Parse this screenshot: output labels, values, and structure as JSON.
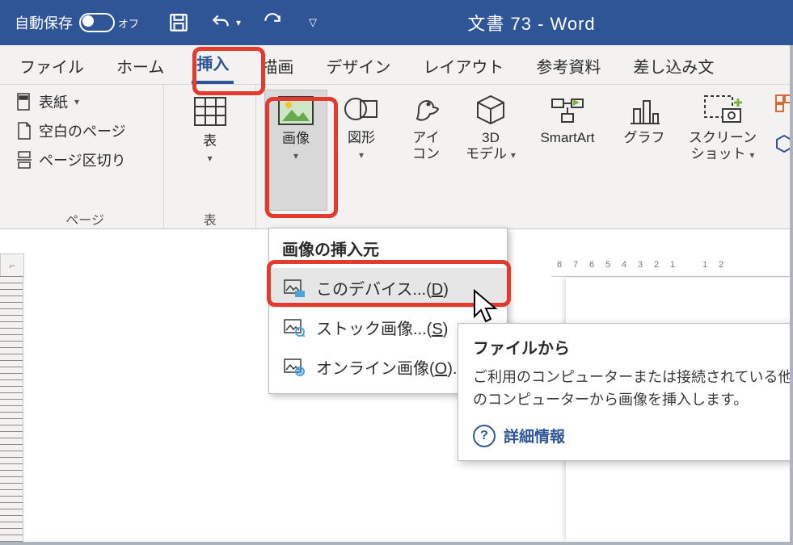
{
  "titlebar": {
    "autosave_label": "自動保存",
    "autosave_state": "オフ",
    "document_title": "文書 73  -  Word"
  },
  "tabs": {
    "items": [
      {
        "label": "ファイル"
      },
      {
        "label": "ホーム"
      },
      {
        "label": "挿入",
        "active": true
      },
      {
        "label": "描画"
      },
      {
        "label": "デザイン"
      },
      {
        "label": "レイアウト"
      },
      {
        "label": "参考資料"
      },
      {
        "label": "差し込み文"
      }
    ]
  },
  "ribbon": {
    "pages_group": {
      "caption": "ページ",
      "cover": "表紙",
      "blank": "空白のページ",
      "break": "ページ区切り"
    },
    "tables_group": {
      "caption": "表",
      "table": "表"
    },
    "illust_group": {
      "image": "画像",
      "shapes": "図形",
      "icons_l1": "アイ",
      "icons_l2": "コン",
      "model_l1": "3D",
      "model_l2": "モデル",
      "smartart": "SmartArt",
      "chart": "グラフ",
      "screenshot_l1": "スクリーン",
      "screenshot_l2": "ショット"
    }
  },
  "dropdown": {
    "title": "画像の挿入元",
    "items": [
      {
        "label": "このデバイス...(",
        "mnemonic": "D",
        "tail": ")"
      },
      {
        "label": "ストック画像...(",
        "mnemonic": "S",
        "tail": ")"
      },
      {
        "label": "オンライン画像(",
        "mnemonic": "O",
        "tail": ")..."
      }
    ]
  },
  "tooltip": {
    "title": "ファイルから",
    "body": "ご利用のコンピューターまたは接続されている他のコンピューターから画像を挿入します。",
    "link": "詳細情報"
  },
  "hruler_ticks": [
    "8",
    "7",
    "6",
    "5",
    "4",
    "3",
    "2",
    "1",
    "",
    "1",
    "2"
  ]
}
